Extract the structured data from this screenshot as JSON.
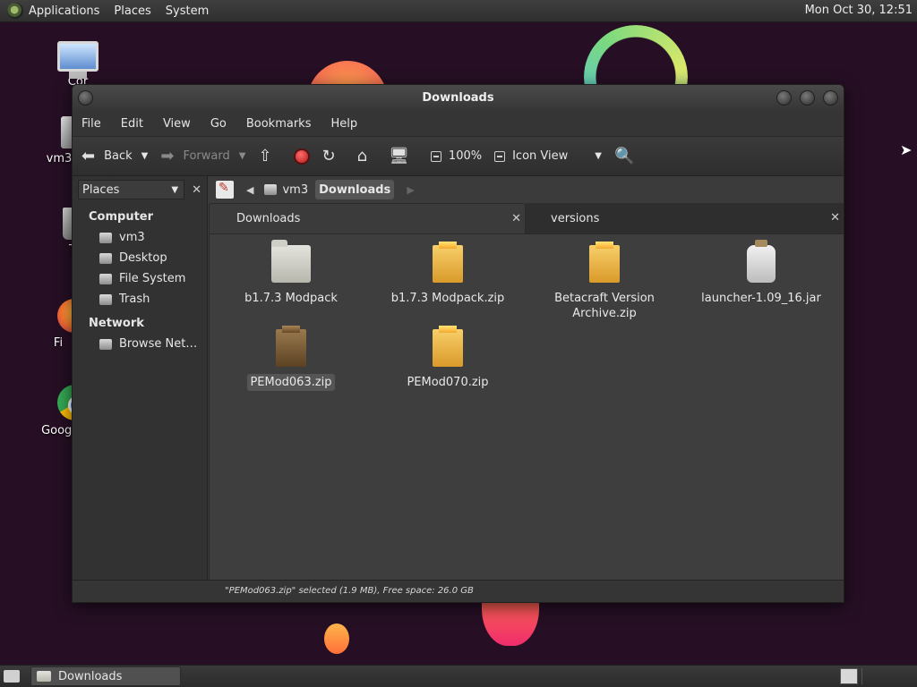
{
  "top_panel": {
    "menus": [
      "Applications",
      "Places",
      "System"
    ],
    "clock": "Mon Oct 30, 12:51"
  },
  "desktop": {
    "icons": [
      {
        "label": "Cor",
        "icon": "computer-icon"
      },
      {
        "label": "vm3",
        "icon": "home-folder-icon"
      },
      {
        "label": "T",
        "icon": "trash-icon"
      },
      {
        "label": "Fi",
        "icon": "firefox-icon"
      },
      {
        "label": "Googl",
        "icon": "chrome-icon"
      }
    ]
  },
  "window": {
    "title": "Downloads",
    "menubar": [
      "File",
      "Edit",
      "View",
      "Go",
      "Bookmarks",
      "Help"
    ],
    "toolbar": {
      "back": "Back",
      "forward": "Forward",
      "zoom": "100%",
      "view_mode": "Icon View"
    },
    "sidepane": {
      "header": "Places",
      "sections": [
        {
          "title": "Computer",
          "items": [
            "vm3",
            "Desktop",
            "File System",
            "Trash"
          ]
        },
        {
          "title": "Network",
          "items": [
            "Browse Net…"
          ]
        }
      ]
    },
    "pathbar": {
      "crumbs": [
        "vm3",
        "Downloads"
      ]
    },
    "tabs": [
      {
        "label": "Downloads",
        "active": true
      },
      {
        "label": "versions",
        "active": false
      }
    ],
    "files": [
      {
        "name": "b1.7.3 Modpack",
        "type": "folder"
      },
      {
        "name": "b1.7.3 Modpack.zip",
        "type": "zip"
      },
      {
        "name": "Betacraft Version Archive.zip",
        "type": "zip"
      },
      {
        "name": "launcher-1.09_16.jar",
        "type": "jar"
      },
      {
        "name": "PEMod063.zip",
        "type": "zip",
        "selected": true
      },
      {
        "name": "PEMod070.zip",
        "type": "zip"
      }
    ],
    "status": "\"PEMod063.zip\" selected (1.9 MB), Free space: 26.0 GB"
  },
  "bottom_panel": {
    "task": "Downloads"
  }
}
